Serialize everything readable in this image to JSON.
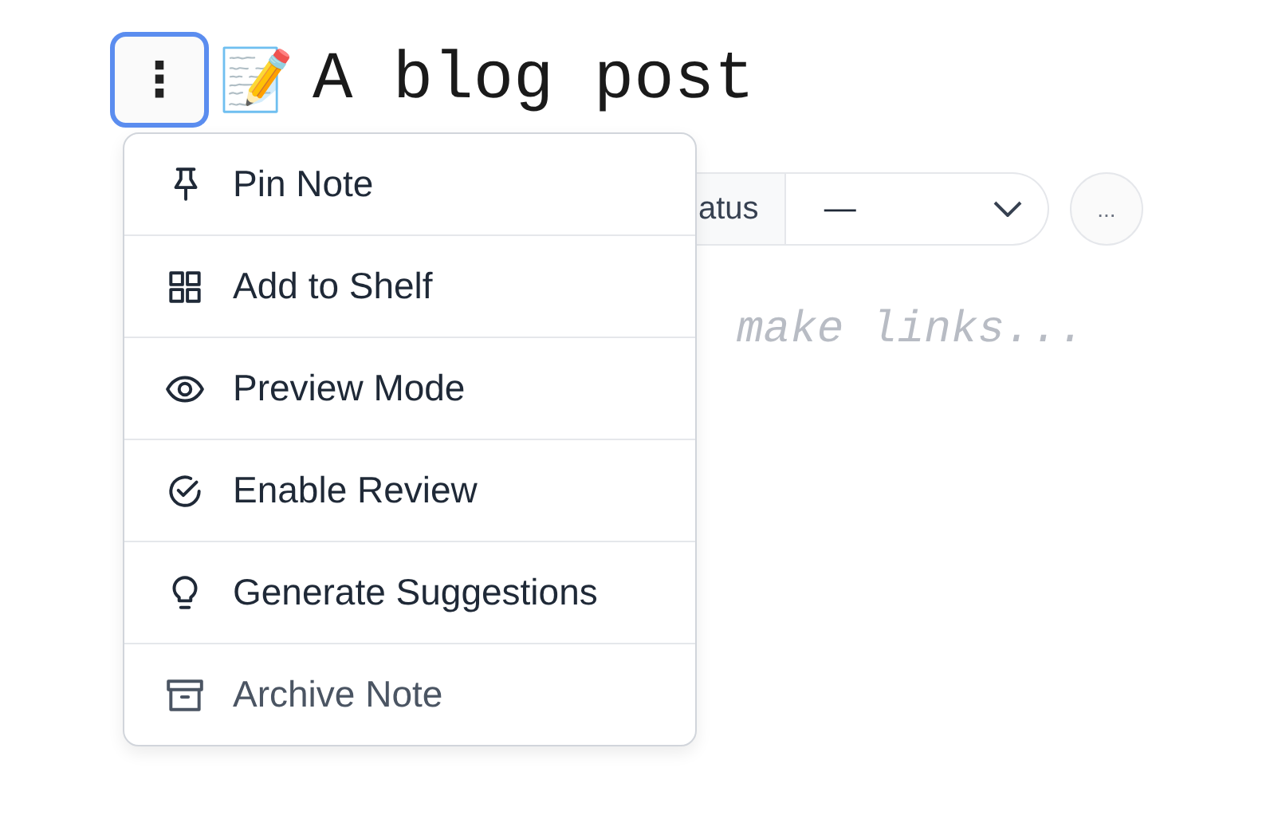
{
  "header": {
    "menu_button": {
      "label": "⋮",
      "focused": true
    },
    "emoji": "📝",
    "title": "A blog post"
  },
  "toolbar": {
    "status_label": "atus",
    "status_value": "—",
    "more_button": "..."
  },
  "editor": {
    "placeholder": "make links..."
  },
  "menu": {
    "items": [
      {
        "label": "Pin Note",
        "kind": "pin",
        "muted": false
      },
      {
        "label": "Add to Shelf",
        "kind": "grid",
        "muted": false
      },
      {
        "label": "Preview Mode",
        "kind": "eye",
        "muted": false
      },
      {
        "label": "Enable Review",
        "kind": "check",
        "muted": false
      },
      {
        "label": "Generate Suggestions",
        "kind": "bulb",
        "muted": false
      },
      {
        "label": "Archive Note",
        "kind": "archive",
        "muted": true
      }
    ]
  }
}
